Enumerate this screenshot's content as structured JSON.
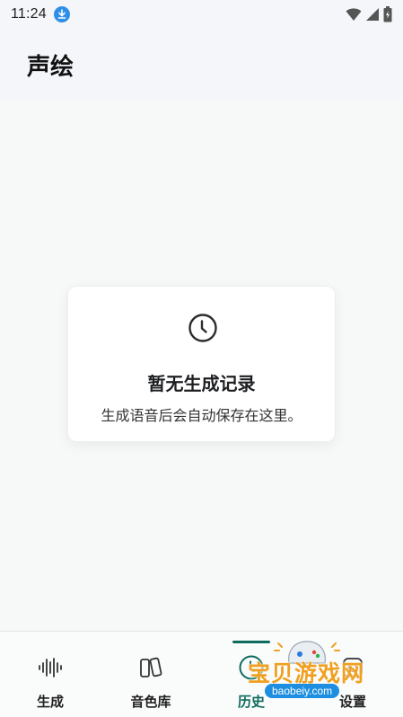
{
  "status_bar": {
    "time": "11:24",
    "download_icon": "download-icon",
    "wifi_icon": "wifi-icon",
    "signal_icon": "cell-signal-icon",
    "battery_icon": "battery-icon"
  },
  "header": {
    "title": "声绘"
  },
  "empty_state": {
    "icon": "clock-icon",
    "title": "暂无生成记录",
    "subtitle": "生成语音后会自动保存在这里。"
  },
  "bottom_nav": {
    "items": [
      {
        "label": "生成",
        "icon": "waveform-icon",
        "active": false
      },
      {
        "label": "音色库",
        "icon": "library-icon",
        "active": false
      },
      {
        "label": "历史",
        "icon": "history-icon",
        "active": true
      },
      {
        "label": "设置",
        "icon": "settings-icon",
        "active": false
      }
    ]
  },
  "watermark": {
    "text": "宝贝游戏网",
    "url": "baobeiy.com"
  },
  "colors": {
    "accent": "#0f6b5e",
    "background": "#f7f8f8",
    "header_bg": "#f5f6fa",
    "card_bg": "#ffffff",
    "watermark_orange": "#f0a020",
    "watermark_blue": "#1e8fe0"
  }
}
